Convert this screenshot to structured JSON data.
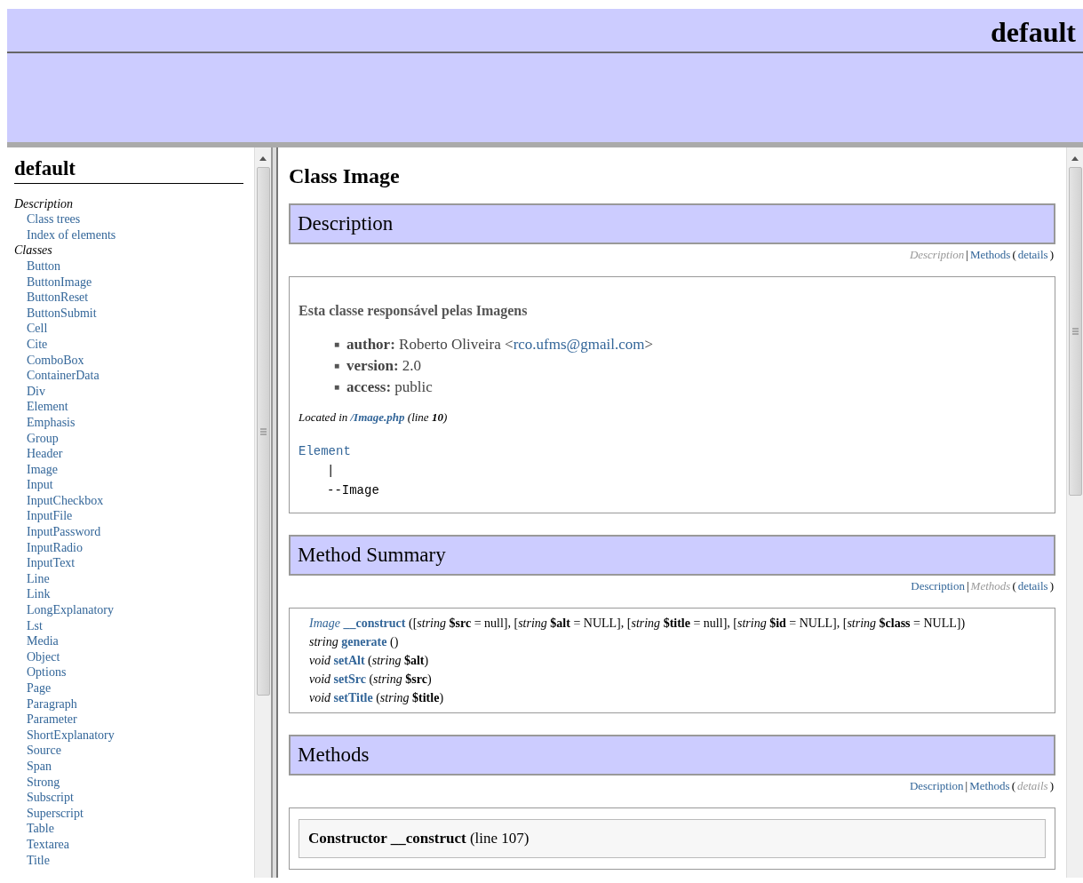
{
  "banner": {
    "title": "default"
  },
  "sidebar": {
    "title": "default",
    "sections": [
      {
        "label": "Description",
        "children": [
          {
            "label": "Class trees"
          },
          {
            "label": "Index of elements"
          }
        ]
      },
      {
        "label": "Classes",
        "children": [
          {
            "label": "Button"
          },
          {
            "label": "ButtonImage"
          },
          {
            "label": "ButtonReset"
          },
          {
            "label": "ButtonSubmit"
          },
          {
            "label": "Cell"
          },
          {
            "label": "Cite"
          },
          {
            "label": "ComboBox"
          },
          {
            "label": "ContainerData"
          },
          {
            "label": "Div"
          },
          {
            "label": "Element"
          },
          {
            "label": "Emphasis"
          },
          {
            "label": "Group"
          },
          {
            "label": "Header"
          },
          {
            "label": "Image"
          },
          {
            "label": "Input"
          },
          {
            "label": "InputCheckbox"
          },
          {
            "label": "InputFile"
          },
          {
            "label": "InputPassword"
          },
          {
            "label": "InputRadio"
          },
          {
            "label": "InputText"
          },
          {
            "label": "Line"
          },
          {
            "label": "Link"
          },
          {
            "label": "LongExplanatory"
          },
          {
            "label": "Lst"
          },
          {
            "label": "Media"
          },
          {
            "label": "Object"
          },
          {
            "label": "Options"
          },
          {
            "label": "Page"
          },
          {
            "label": "Paragraph"
          },
          {
            "label": "Parameter"
          },
          {
            "label": "ShortExplanatory"
          },
          {
            "label": "Source"
          },
          {
            "label": "Span"
          },
          {
            "label": "Strong"
          },
          {
            "label": "Subscript"
          },
          {
            "label": "Superscript"
          },
          {
            "label": "Table"
          },
          {
            "label": "Textarea"
          },
          {
            "label": "Title"
          }
        ]
      }
    ]
  },
  "content": {
    "title": "Class Image",
    "sections": [
      {
        "kind": "description",
        "heading": "Description",
        "nav": [
          {
            "kind": "link",
            "text": "Description",
            "selected": true
          },
          {
            "kind": "sep",
            "text": "|"
          },
          {
            "kind": "link",
            "text": "Methods",
            "selected": false
          },
          {
            "kind": "sep",
            "text": "("
          },
          {
            "kind": "link",
            "text": "details",
            "selected": false
          },
          {
            "kind": "sep",
            "text": ")"
          }
        ],
        "summary": "Esta classe responsável pelas Imagens",
        "tags": [
          {
            "marker": "■",
            "name": "author:",
            "value": "Roberto Oliveira <",
            "link": "rco.ufms@gmail.com",
            "after": ">"
          },
          {
            "marker": "■",
            "name": "version:",
            "value": "2.0"
          },
          {
            "marker": "■",
            "name": "access:",
            "value": "public"
          }
        ],
        "located": {
          "prefix": "Located in",
          "file": "/Image.php",
          "suffix": "(line **10**)"
        },
        "tree": {
          "parent": "Element",
          "connector": "|",
          "child": "--Image"
        }
      },
      {
        "kind": "summary",
        "heading": "Method Summary",
        "nav": [
          {
            "kind": "link",
            "text": "Description",
            "selected": false
          },
          {
            "kind": "sep",
            "text": "|"
          },
          {
            "kind": "link",
            "text": "Methods",
            "selected": true
          },
          {
            "kind": "sep",
            "text": "("
          },
          {
            "kind": "link",
            "text": "details",
            "selected": false
          },
          {
            "kind": "sep",
            "text": ")"
          }
        ],
        "methods": [
          {
            "return_type": "Image",
            "return_link": true,
            "name": "__construct",
            "params": "([*string* **$src** = null], [*string* **$alt** = NULL], [*string* **$title** = null], [*string* **$id** = NULL], [*string* **$class** = NULL])"
          },
          {
            "return_type": "string",
            "return_link": false,
            "name": "generate",
            "params": "()"
          },
          {
            "return_type": "void",
            "return_link": false,
            "name": "setAlt",
            "params": "(*string* **$alt**)"
          },
          {
            "return_type": "void",
            "return_link": false,
            "name": "setSrc",
            "params": "(*string* **$src**)"
          },
          {
            "return_type": "void",
            "return_link": false,
            "name": "setTitle",
            "params": "(*string* **$title**)"
          }
        ]
      },
      {
        "kind": "details",
        "heading": "Methods",
        "nav": [
          {
            "kind": "link",
            "text": "Description",
            "selected": false
          },
          {
            "kind": "sep",
            "text": "|"
          },
          {
            "kind": "link",
            "text": "Methods",
            "selected": false
          },
          {
            "kind": "sep",
            "text": "("
          },
          {
            "kind": "link",
            "text": "details",
            "selected": true
          },
          {
            "kind": "sep",
            "text": ")"
          }
        ],
        "entries": [
          {
            "title": "**Constructor __construct** (line 107)"
          }
        ]
      }
    ]
  }
}
